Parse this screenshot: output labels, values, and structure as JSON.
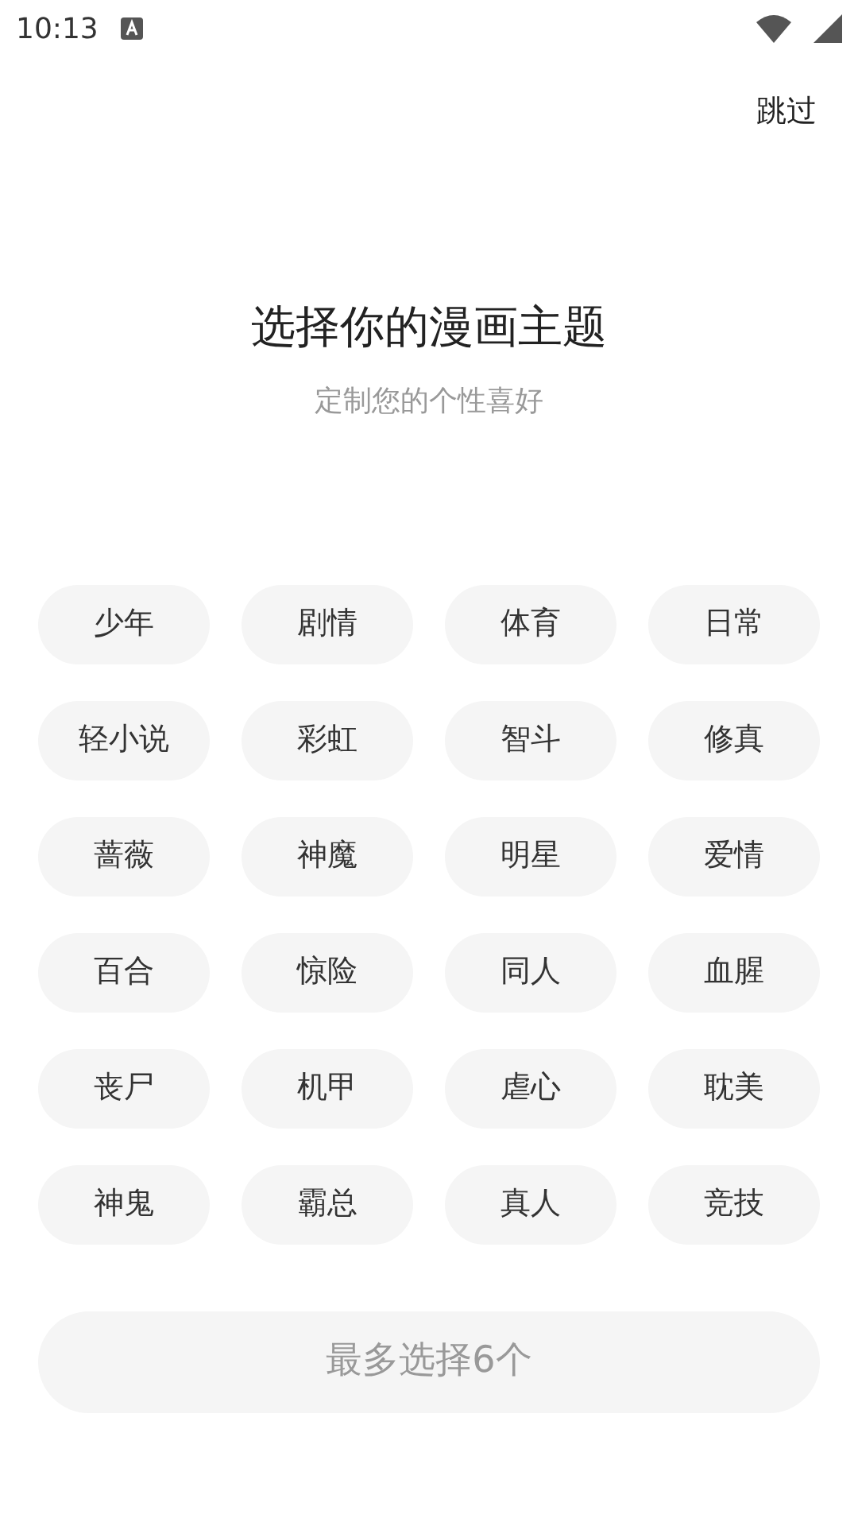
{
  "status_bar": {
    "time": "10:13"
  },
  "skip": "跳过",
  "title": "选择你的漫画主题",
  "subtitle": "定制您的个性喜好",
  "topics": [
    {
      "label": "少年",
      "selected": false
    },
    {
      "label": "剧情",
      "selected": false
    },
    {
      "label": "体育",
      "selected": false
    },
    {
      "label": "日常",
      "selected": false
    },
    {
      "label": "轻小说",
      "selected": false
    },
    {
      "label": "彩虹",
      "selected": false
    },
    {
      "label": "智斗",
      "selected": false
    },
    {
      "label": "修真",
      "selected": false
    },
    {
      "label": "蔷薇",
      "selected": false
    },
    {
      "label": "神魔",
      "selected": false
    },
    {
      "label": "明星",
      "selected": false
    },
    {
      "label": "爱情",
      "selected": false
    },
    {
      "label": "百合",
      "selected": false
    },
    {
      "label": "惊险",
      "selected": false
    },
    {
      "label": "同人",
      "selected": false
    },
    {
      "label": "血腥",
      "selected": false
    },
    {
      "label": "丧尸",
      "selected": false
    },
    {
      "label": "机甲",
      "selected": false
    },
    {
      "label": "虐心",
      "selected": false
    },
    {
      "label": "耽美",
      "selected": false
    },
    {
      "label": "神鬼",
      "selected": false
    },
    {
      "label": "霸总",
      "selected": false
    },
    {
      "label": "真人",
      "selected": false
    },
    {
      "label": "竞技",
      "selected": false
    }
  ],
  "confirm_button": {
    "label": "最多选择6个",
    "disabled": true
  }
}
